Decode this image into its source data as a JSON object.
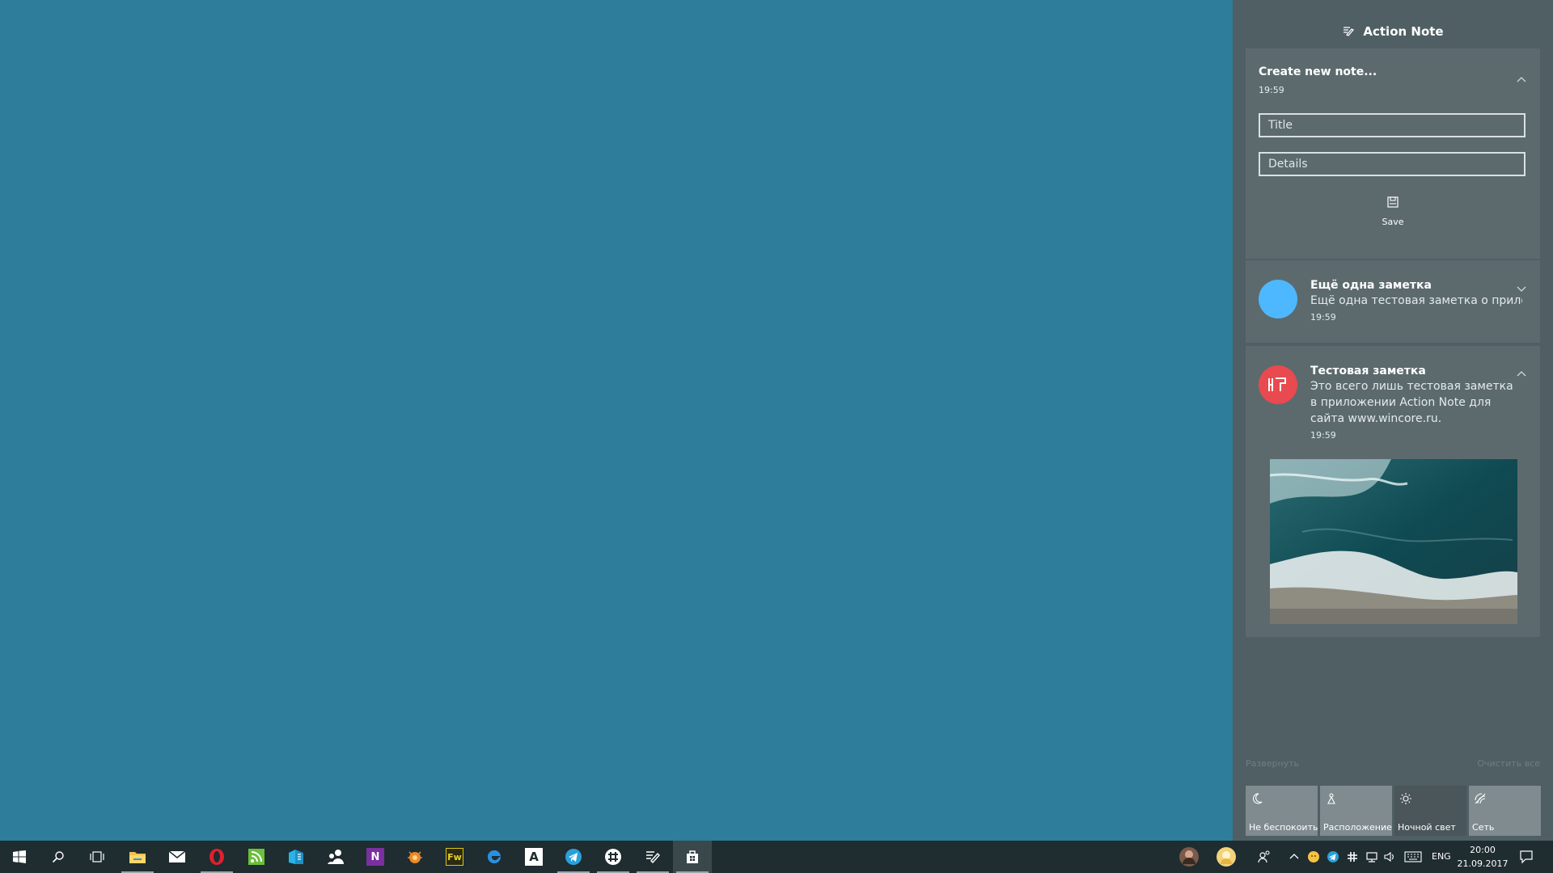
{
  "colors": {
    "desktop": "#2e7d9b",
    "action_center": "#4f5f64",
    "card": "#5c6a6e",
    "taskbar": "#1f2c30",
    "avatar_blue": "#4db8ff",
    "avatar_red": "#e84a4f"
  },
  "action_center": {
    "app_title": "Action Note",
    "app_icon": "action-note-icon",
    "new_note": {
      "title": "Create new note...",
      "time": "19:59",
      "title_placeholder": "Title",
      "details_placeholder": "Details",
      "save_label": "Save"
    },
    "notes": [
      {
        "title": "Ещё одна заметка",
        "body": "Ещё одна тестовая заметка о прило:",
        "time": "19:59",
        "avatar": "blue-circle"
      },
      {
        "title": "Тестовая заметка",
        "body": "Это всего лишь тестовая заметка в приложении Action Note для сайта www.wincore.ru.",
        "time": "19:59",
        "avatar": "app-logo-red",
        "image": "aerial ocean waves photo"
      }
    ],
    "expand_label": "Развернуть",
    "clear_label": "Очистить все",
    "quick_actions": [
      {
        "label": "Не беспокоить",
        "icon": "moon-icon"
      },
      {
        "label": "Расположение",
        "icon": "location-icon"
      },
      {
        "label": "Ночной свет",
        "icon": "brightness-icon"
      },
      {
        "label": "Сеть",
        "icon": "network-icon"
      }
    ]
  },
  "taskbar": {
    "apps": [
      "start-icon",
      "search-icon",
      "task-view-icon",
      "file-explorer-icon",
      "mail-icon",
      "opera-icon",
      "rss-icon",
      "store-building-icon",
      "people-icon",
      "onenote-icon",
      "bug-icon",
      "fireworks-icon",
      "edge-icon",
      "font-icon",
      "telegram-icon",
      "slack-icon",
      "action-note-icon",
      "store-icon"
    ],
    "fireworks_label": "Fw",
    "onenote_label": "N",
    "font_label": "A",
    "language": "ENG",
    "time": "20:00",
    "date": "21.09.2017"
  }
}
